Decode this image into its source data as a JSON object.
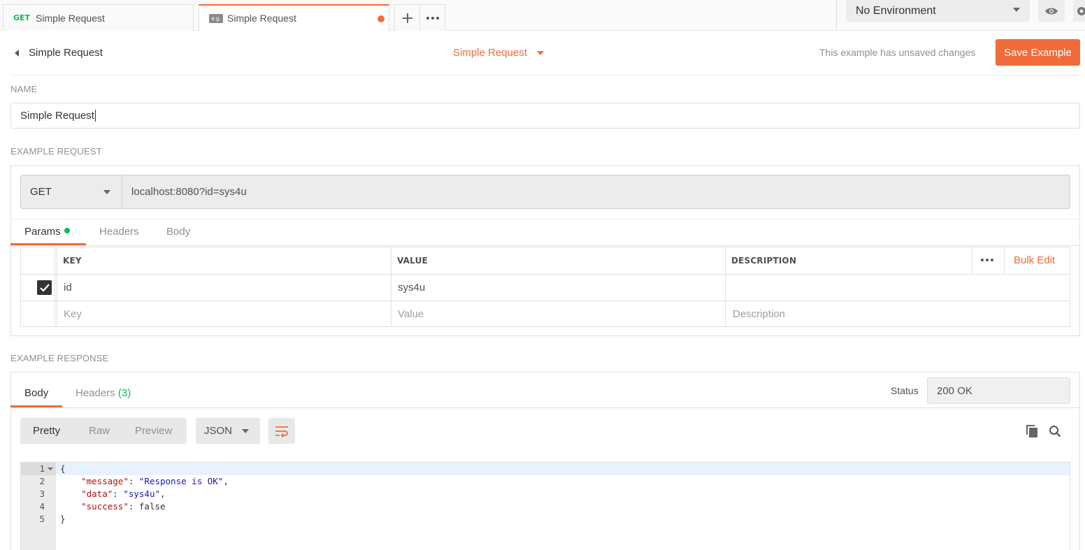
{
  "tabs": [
    {
      "method": "GET",
      "label": "Simple Request"
    },
    {
      "badge": "e.g.",
      "label": "Simple Request"
    }
  ],
  "environment": {
    "selected": "No Environment"
  },
  "header": {
    "back_label": "Simple Request",
    "example_title": "Simple Request",
    "unsaved_text": "This example has unsaved changes",
    "save_label": "Save Example"
  },
  "name_section": {
    "label": "NAME",
    "value": "Simple Request"
  },
  "request": {
    "section_label": "EXAMPLE REQUEST",
    "method": "GET",
    "url": "localhost:8080?id=sys4u",
    "tabs": [
      "Params",
      "Headers",
      "Body"
    ],
    "params_table": {
      "columns": [
        "KEY",
        "VALUE",
        "DESCRIPTION"
      ],
      "bulk_edit": "Bulk Edit",
      "rows": [
        {
          "checked": true,
          "key": "id",
          "value": "sys4u",
          "description": ""
        }
      ],
      "placeholders": {
        "key": "Key",
        "value": "Value",
        "description": "Description"
      }
    }
  },
  "response": {
    "section_label": "EXAMPLE RESPONSE",
    "tabs": {
      "body": "Body",
      "headers": "Headers",
      "headers_count": "(3)"
    },
    "status_label": "Status",
    "status_value": "200 OK",
    "formats": [
      "Pretty",
      "Raw",
      "Preview"
    ],
    "language": "JSON",
    "line_numbers": [
      "1",
      "2",
      "3",
      "4",
      "5"
    ],
    "code": {
      "line1": "{",
      "line2_key": "\"message\"",
      "line2_value": "\"Response is OK\"",
      "line3_key": "\"data\"",
      "line3_value": "\"sys4u\"",
      "line4_key": "\"success\"",
      "line4_value": "false",
      "line5": "}"
    }
  },
  "colors": {
    "accent": "#f26b3a",
    "green": "#0cbb52"
  }
}
